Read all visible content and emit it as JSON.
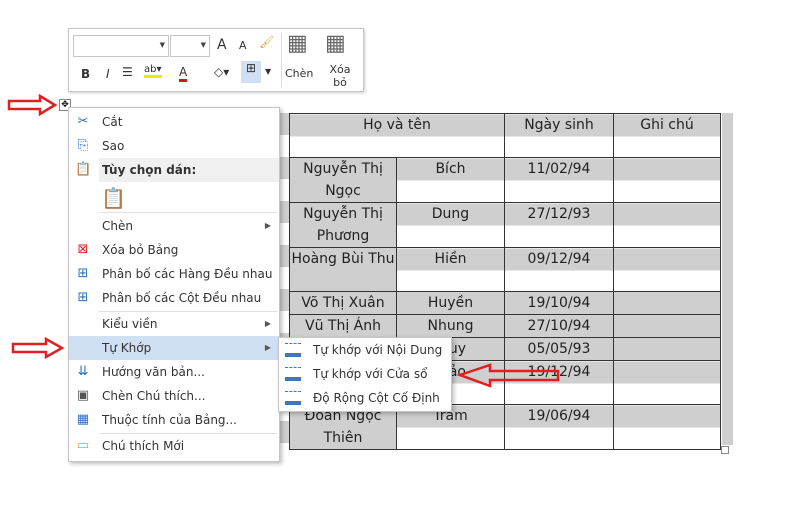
{
  "toolbar": {
    "insert_label": "Chèn",
    "delete_label": "Xóa bỏ",
    "bold": "B",
    "italic": "I",
    "grow": "A",
    "shrink": "A",
    "font_color": "A"
  },
  "table": {
    "header": [
      "Họ và tên",
      "Ngày sinh",
      "Ghi chú"
    ],
    "rows": [
      {
        "c1": "Nguyễn Thị Ngọc",
        "c2": "Bích",
        "c3": "11/02/94"
      },
      {
        "c1": "Nguyễn Thị Phương",
        "c2": "Dung",
        "c3": "27/12/93"
      },
      {
        "c1": "Hoàng Bùi Thu",
        "c2": "Hiền",
        "c3": "09/12/94"
      },
      {
        "c1": "Võ Thị Xuân",
        "c2": "Huyền",
        "c3": "19/10/94"
      },
      {
        "c1": "Vũ Thị Ánh",
        "c2": "Nhung",
        "c3": "27/10/94"
      },
      {
        "c1": "",
        "c2": "uy",
        "c3": "05/05/93"
      },
      {
        "c1": "",
        "c2": "ảo",
        "c3": "19/12/94"
      },
      {
        "c1": "Đoàn Ngọc Thiên",
        "c2": "Trâm",
        "c3": "19/06/94"
      }
    ]
  },
  "menu": {
    "cut": "Cắt",
    "copy": "Sao",
    "paste_options": "Tùy chọn dán:",
    "insert": "Chèn",
    "delete_table": "Xóa bỏ Bảng",
    "distribute_rows": "Phân bố các Hàng Đều nhau",
    "distribute_cols": "Phân bố các Cột Đều nhau",
    "border_styles": "Kiểu viền",
    "autofit": "Tự Khớp",
    "text_direction": "Hướng văn bản...",
    "insert_caption": "Chèn Chú thích...",
    "table_properties": "Thuộc tính của Bảng...",
    "new_comment": "Chú thích Mới"
  },
  "submenu": {
    "fit_contents": "Tự khớp với Nội Dung",
    "fit_window": "Tự khớp với Cửa sổ",
    "fixed_width": "Độ Rộng Cột Cố Định"
  },
  "colors": {
    "arrow": "#e02020",
    "highlight": "#cfe0f5",
    "cell_shade": "#cfcfcf"
  }
}
